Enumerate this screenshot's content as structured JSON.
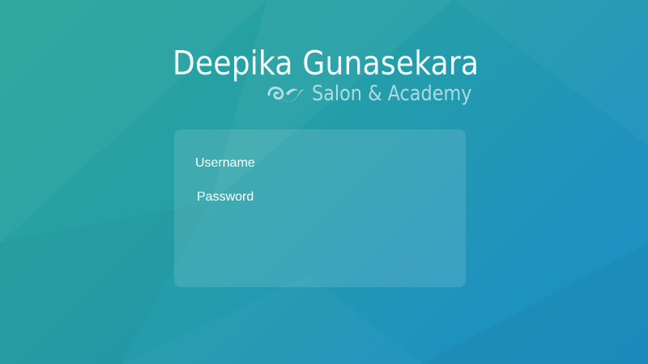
{
  "brand": {
    "name": "Deepika Gunasekara",
    "tagline": "Salon & Academy",
    "logo_icon": "leaf-swirl-icon"
  },
  "login": {
    "username_placeholder": "Username",
    "password_placeholder": "Password"
  },
  "colors": {
    "background_start": "#2aa59a",
    "background_end": "#1b8fc2",
    "text": "#ffffff"
  }
}
